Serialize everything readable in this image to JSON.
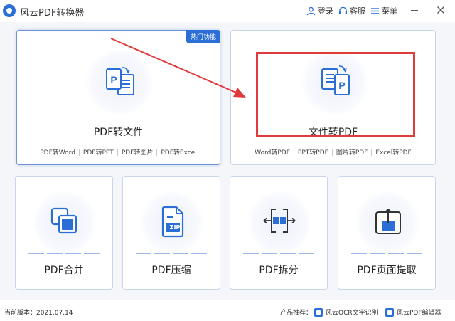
{
  "app": {
    "title": "风云PDF转换器"
  },
  "titlebar": {
    "login_label": "登录",
    "support_label": "客服",
    "menu_label": "菜单"
  },
  "cards": {
    "pdf_to_file": {
      "label": "PDF转文件",
      "badge": "热门功能",
      "subs": [
        "PDF转Word",
        "PDF转PPT",
        "PDF转图片",
        "PDF转Excel"
      ]
    },
    "file_to_pdf": {
      "label": "文件转PDF",
      "subs": [
        "Word转PDF",
        "PPT转PDF",
        "图片转PDF",
        "Excel转PDF"
      ]
    },
    "merge": {
      "label": "PDF合并"
    },
    "compress": {
      "label": "PDF压缩",
      "icon_text": "ZIP"
    },
    "split": {
      "label": "PDF拆分"
    },
    "extract": {
      "label": "PDF页面提取"
    }
  },
  "statusbar": {
    "version": "当前版本：2021.07.14",
    "promo_label": "产品推荐：",
    "promo_ocr": "风云OCR文字识别",
    "promo_editor": "风云PDF编辑器"
  },
  "colors": {
    "accent": "#2b6fd6",
    "highlight_red": "#e03a3a",
    "card_border": "#c9d5ea",
    "background": "#f4f6fa"
  }
}
